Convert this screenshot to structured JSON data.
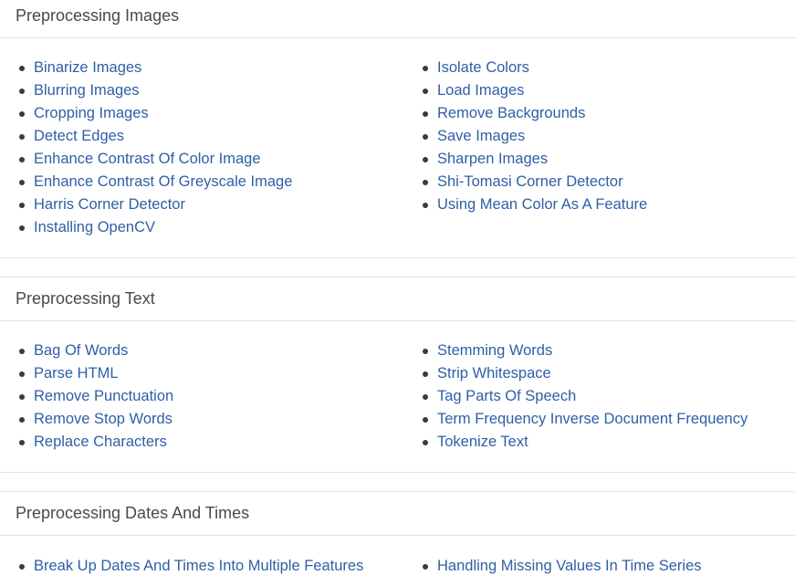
{
  "sections": [
    {
      "title": "Preprocessing Images",
      "left": [
        "Binarize Images",
        "Blurring Images",
        "Cropping Images",
        "Detect Edges",
        "Enhance Contrast Of Color Image",
        "Enhance Contrast Of Greyscale Image",
        "Harris Corner Detector",
        "Installing OpenCV"
      ],
      "right": [
        "Isolate Colors",
        "Load Images",
        "Remove Backgrounds",
        "Save Images",
        "Sharpen Images",
        "Shi-Tomasi Corner Detector",
        "Using Mean Color As A Feature"
      ]
    },
    {
      "title": "Preprocessing Text",
      "left": [
        "Bag Of Words",
        "Parse HTML",
        "Remove Punctuation",
        "Remove Stop Words",
        "Replace Characters"
      ],
      "right": [
        "Stemming Words",
        "Strip Whitespace",
        "Tag Parts Of Speech",
        "Term Frequency Inverse Document Frequency",
        "Tokenize Text"
      ]
    },
    {
      "title": "Preprocessing Dates And Times",
      "left": [
        "Break Up Dates And Times Into Multiple Features"
      ],
      "right": [
        "Handling Missing Values In Time Series"
      ]
    }
  ]
}
